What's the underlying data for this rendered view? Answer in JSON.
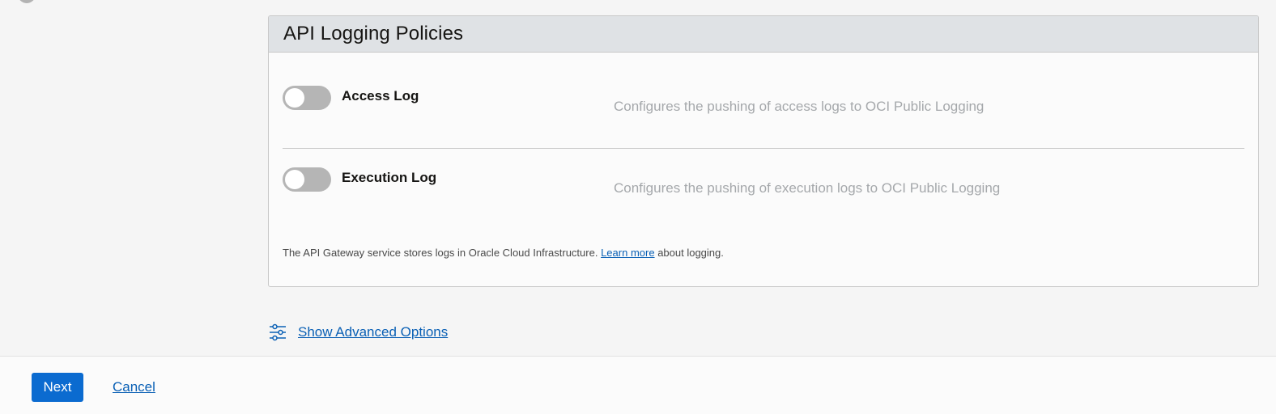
{
  "panel": {
    "title": "API Logging Policies",
    "logs": [
      {
        "label": "Access Log",
        "enabled": false,
        "description": "Configures the pushing of access logs to OCI Public Logging"
      },
      {
        "label": "Execution Log",
        "enabled": false,
        "description": "Configures the pushing of execution logs to OCI Public Logging"
      }
    ],
    "info": {
      "prefix": "The API Gateway service stores logs in Oracle Cloud Infrastructure.",
      "link": "Learn more",
      "suffix": "about logging."
    }
  },
  "advanced": {
    "icon": "sliders-icon",
    "label": "Show Advanced Options"
  },
  "footer": {
    "next_label": "Next",
    "cancel_label": "Cancel"
  },
  "colors": {
    "accent": "#0b6bd0",
    "link": "#0a60b5",
    "toggle_off": "#b5b5b5",
    "header_bg": "#dfe2e5",
    "description": "#a5a8ab"
  }
}
